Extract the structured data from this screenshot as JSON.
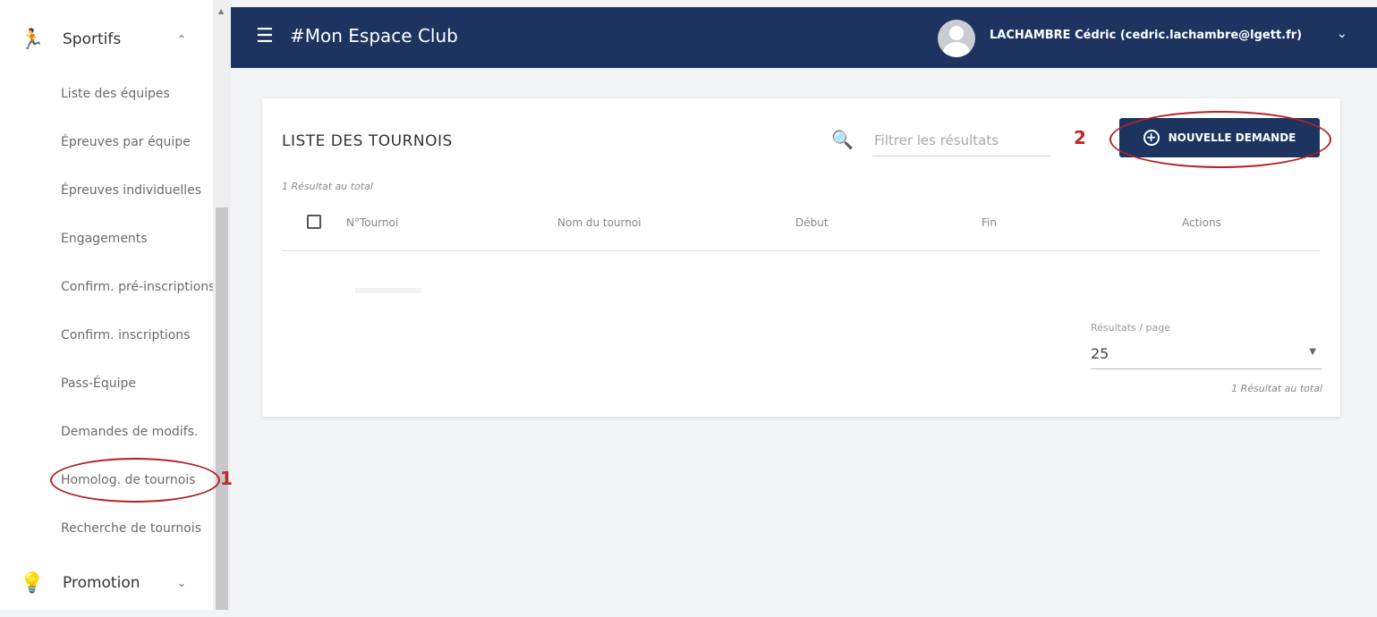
{
  "sidebar": {
    "section_sportifs": "Sportifs",
    "section_promotion": "Promotion",
    "items": [
      {
        "label": "Liste des équipes"
      },
      {
        "label": "Épreuves par équipe"
      },
      {
        "label": "Épreuves individuelles"
      },
      {
        "label": "Engagements"
      },
      {
        "label": "Confirm. pré-inscriptions"
      },
      {
        "label": "Confirm. inscriptions"
      },
      {
        "label": "Pass-Équipe"
      },
      {
        "label": "Demandes de modifs."
      },
      {
        "label": "Homolog. de tournois"
      },
      {
        "label": "Recherche de tournois"
      }
    ]
  },
  "header": {
    "app_title": "#Mon Espace Club",
    "user_name": "LACHAMBRE Cédric (cedric.lachambre@lgett.fr)"
  },
  "card": {
    "title": "LISTE DES TOURNOIS",
    "search_placeholder": "Filtrer les résultats",
    "new_request_label": "NOUVELLE DEMANDE",
    "result_count_top": "1 Résultat au total",
    "columns": [
      "N°Tournoi",
      "Nom du tournoi",
      "Début",
      "Fin",
      "Actions"
    ],
    "per_page_label": "Résultats / page",
    "per_page_value": "25",
    "result_count_bottom": "1 Résultat au total"
  },
  "annotations": [
    "1",
    "2"
  ],
  "colors": {
    "header_bg": "#1d3461",
    "annotation_red": "#b32222"
  }
}
